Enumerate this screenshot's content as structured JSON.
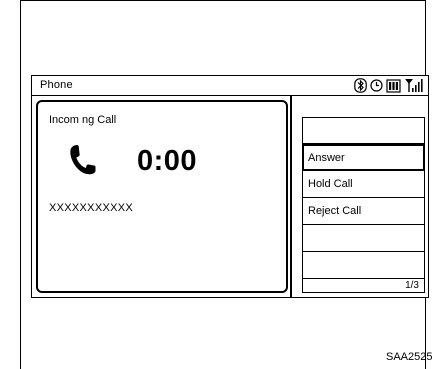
{
  "screen": {
    "title": "Phone",
    "status_icons": [
      "bluetooth-icon",
      "clock-icon",
      "battery-icon",
      "signal-strength-icon"
    ]
  },
  "call": {
    "label": "Incom ng Call",
    "timer": "0:00",
    "caller_number": "XXXXXXXXXXX"
  },
  "menu": {
    "items": [
      {
        "label": ""
      },
      {
        "label": "Answer",
        "selected": true
      },
      {
        "label": "Hold Call"
      },
      {
        "label": "Reject Call"
      },
      {
        "label": ""
      },
      {
        "label": ""
      }
    ],
    "page_indicator": "1/3"
  },
  "figure_code": "SAA2525"
}
